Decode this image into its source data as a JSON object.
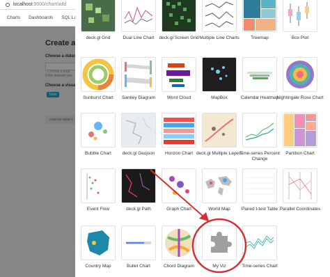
{
  "browser": {
    "url_host": "localhost",
    "url_path": ":9000/chart/add"
  },
  "nav": {
    "items": [
      "Charts",
      "Dashboards",
      "SQL Lab"
    ]
  },
  "background_page": {
    "title": "Create a n",
    "choose_dataset_label": "Choose a datase",
    "dataset_placeholder": "Choose a data",
    "dataset_help": "If the dataset you",
    "choose_viz_label": "Choose a visuali",
    "viz_tag": "Table",
    "create_button": "CREATE NEW C"
  },
  "viz_gallery": {
    "rows": [
      [
        {
          "label": "deck.gl Grid",
          "icon": "deckgl-grid-thumbnail"
        },
        {
          "label": "Dual Line Chart",
          "icon": "dual-line-chart-thumbnail"
        },
        {
          "label": "deck.gl Screen Grid",
          "icon": "deckgl-screen-grid-thumbnail"
        },
        {
          "label": "Multiple Line Charts",
          "icon": "multiple-line-charts-thumbnail"
        },
        {
          "label": "Treemap",
          "icon": "treemap-thumbnail"
        },
        {
          "label": "Box Plot",
          "icon": "box-plot-thumbnail"
        }
      ],
      [
        {
          "label": "Sunburst Chart",
          "icon": "sunburst-chart-thumbnail"
        },
        {
          "label": "Sankey Diagram",
          "icon": "sankey-diagram-thumbnail"
        },
        {
          "label": "Word Cloud",
          "icon": "word-cloud-thumbnail"
        },
        {
          "label": "MapBox",
          "icon": "mapbox-thumbnail"
        },
        {
          "label": "Calendar Heatmap",
          "icon": "calendar-heatmap-thumbnail"
        },
        {
          "label": "Nightingale Rose Chart",
          "icon": "nightingale-rose-thumbnail"
        }
      ],
      [
        {
          "label": "Bubble Chart",
          "icon": "bubble-chart-thumbnail"
        },
        {
          "label": "deck.gl Geojson",
          "icon": "deckgl-geojson-thumbnail"
        },
        {
          "label": "Horizon Chart",
          "icon": "horizon-chart-thumbnail"
        },
        {
          "label": "deck.gl Multiple Layers",
          "icon": "deckgl-multiple-layers-thumbnail"
        },
        {
          "label": "Time-series Percent Change",
          "icon": "time-series-percent-change-thumbnail"
        },
        {
          "label": "Partition Chart",
          "icon": "partition-chart-thumbnail"
        }
      ],
      [
        {
          "label": "Event Flow",
          "icon": "event-flow-thumbnail"
        },
        {
          "label": "deck.gl Path",
          "icon": "deckgl-path-thumbnail"
        },
        {
          "label": "Graph Chart",
          "icon": "graph-chart-thumbnail"
        },
        {
          "label": "World Map",
          "icon": "world-map-thumbnail"
        },
        {
          "label": "Paired t-test Table",
          "icon": "paired-t-test-table-thumbnail"
        },
        {
          "label": "Parallel Coordinates",
          "icon": "parallel-coordinates-thumbnail"
        }
      ],
      [
        {
          "label": "Country Map",
          "icon": "country-map-thumbnail"
        },
        {
          "label": "Bullet Chart",
          "icon": "bullet-chart-thumbnail"
        },
        {
          "label": "Chord Diagram",
          "icon": "chord-diagram-thumbnail"
        },
        {
          "label": "My Viz",
          "icon": "puzzle-piece-icon"
        },
        {
          "label": "Time-series Chart",
          "icon": "time-series-chart-thumbnail"
        }
      ]
    ]
  },
  "annotation": {
    "color": "#d32f2f"
  }
}
